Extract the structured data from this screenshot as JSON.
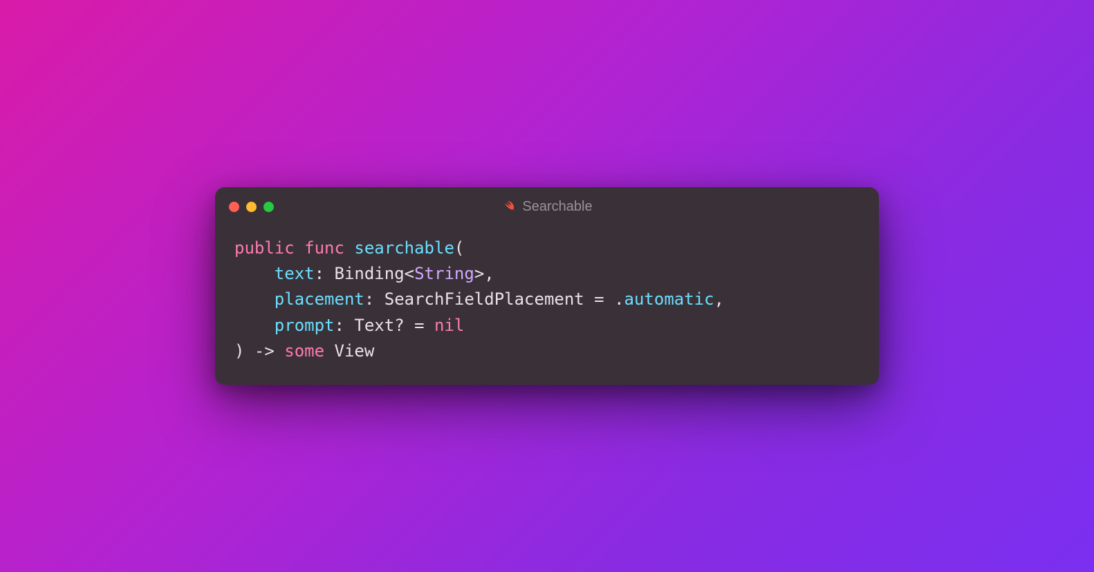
{
  "window": {
    "title": "Searchable"
  },
  "code": {
    "l1_public": "public",
    "l1_func": "func",
    "l1_name": "searchable",
    "l1_paren": "(",
    "l2_indent": "    ",
    "l2_param": "text",
    "l2_colon": ": ",
    "l2_type_bind": "Binding",
    "l2_lt": "<",
    "l2_string": "String",
    "l2_gt_comma": ">,",
    "l3_indent": "    ",
    "l3_param": "placement",
    "l3_colon": ": ",
    "l3_type": "SearchFieldPlacement",
    "l3_eq": " = .",
    "l3_val": "automatic",
    "l3_comma": ",",
    "l4_indent": "    ",
    "l4_param": "prompt",
    "l4_colon": ": ",
    "l4_type": "Text",
    "l4_q_eq": "? = ",
    "l4_nil": "nil",
    "l5_close_arrow": ") -> ",
    "l5_some": "some",
    "l5_sp": " ",
    "l5_view": "View"
  }
}
